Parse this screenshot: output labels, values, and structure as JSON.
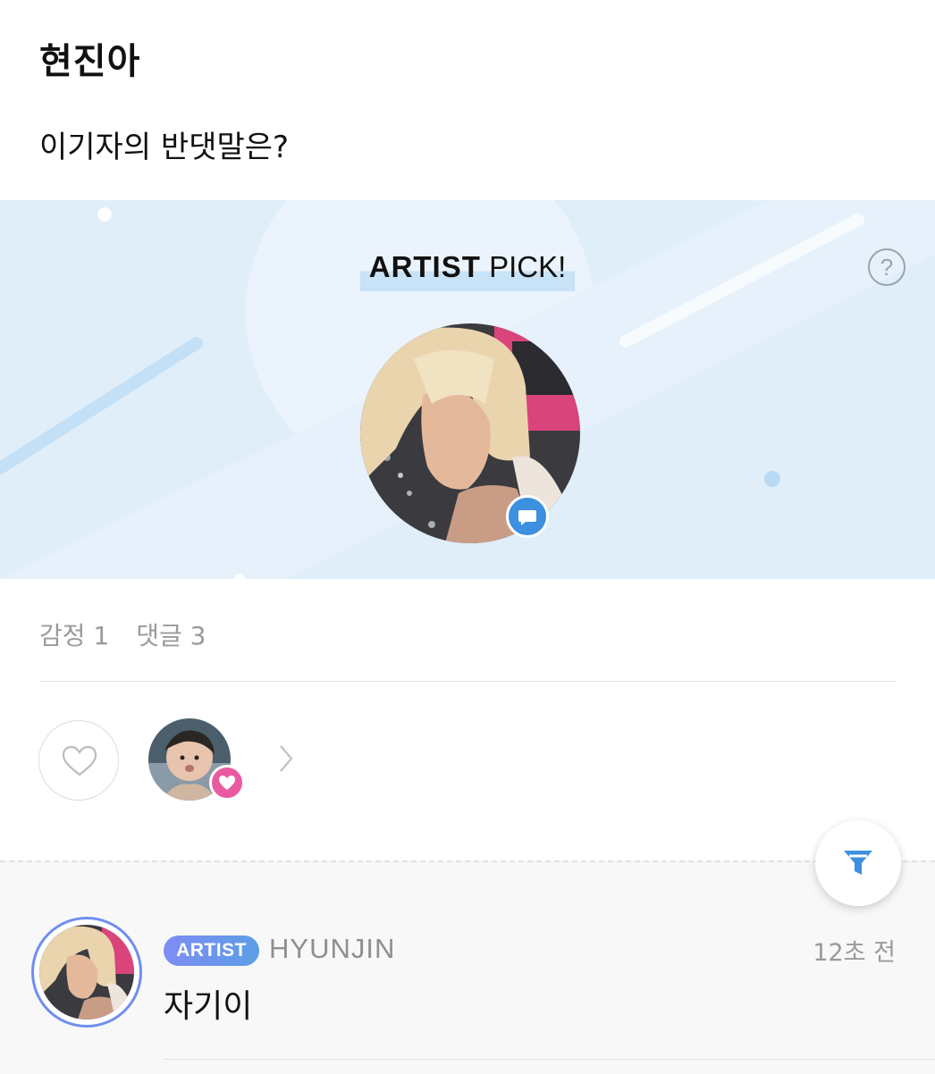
{
  "post": {
    "title": "현진아",
    "body": "이기자의 반댓말은?"
  },
  "banner": {
    "label_bold": "ARTIST",
    "label_regular": " PICK!",
    "help_icon_text": "?",
    "help_icon": "question-circle-icon",
    "badge_icon": "chat-bubble-icon",
    "colors": {
      "background": "#dfeef9",
      "highlight": "#c8e2f7",
      "badge": "#3d8fe0"
    }
  },
  "stats": {
    "emotion": "감정 1",
    "comments": "댓글 3"
  },
  "reactions": {
    "like_icon": "heart-outline-icon",
    "reactor_badge_icon": "heart-icon",
    "more_icon": "chevron-right-icon",
    "badge_color": "#ea5aa0"
  },
  "filter": {
    "icon": "filter-icon",
    "color": "#3d8fe0"
  },
  "comment": {
    "badge": "ARTIST",
    "author": "HYUNJIN",
    "time": "12초 전",
    "text": "자기이"
  }
}
